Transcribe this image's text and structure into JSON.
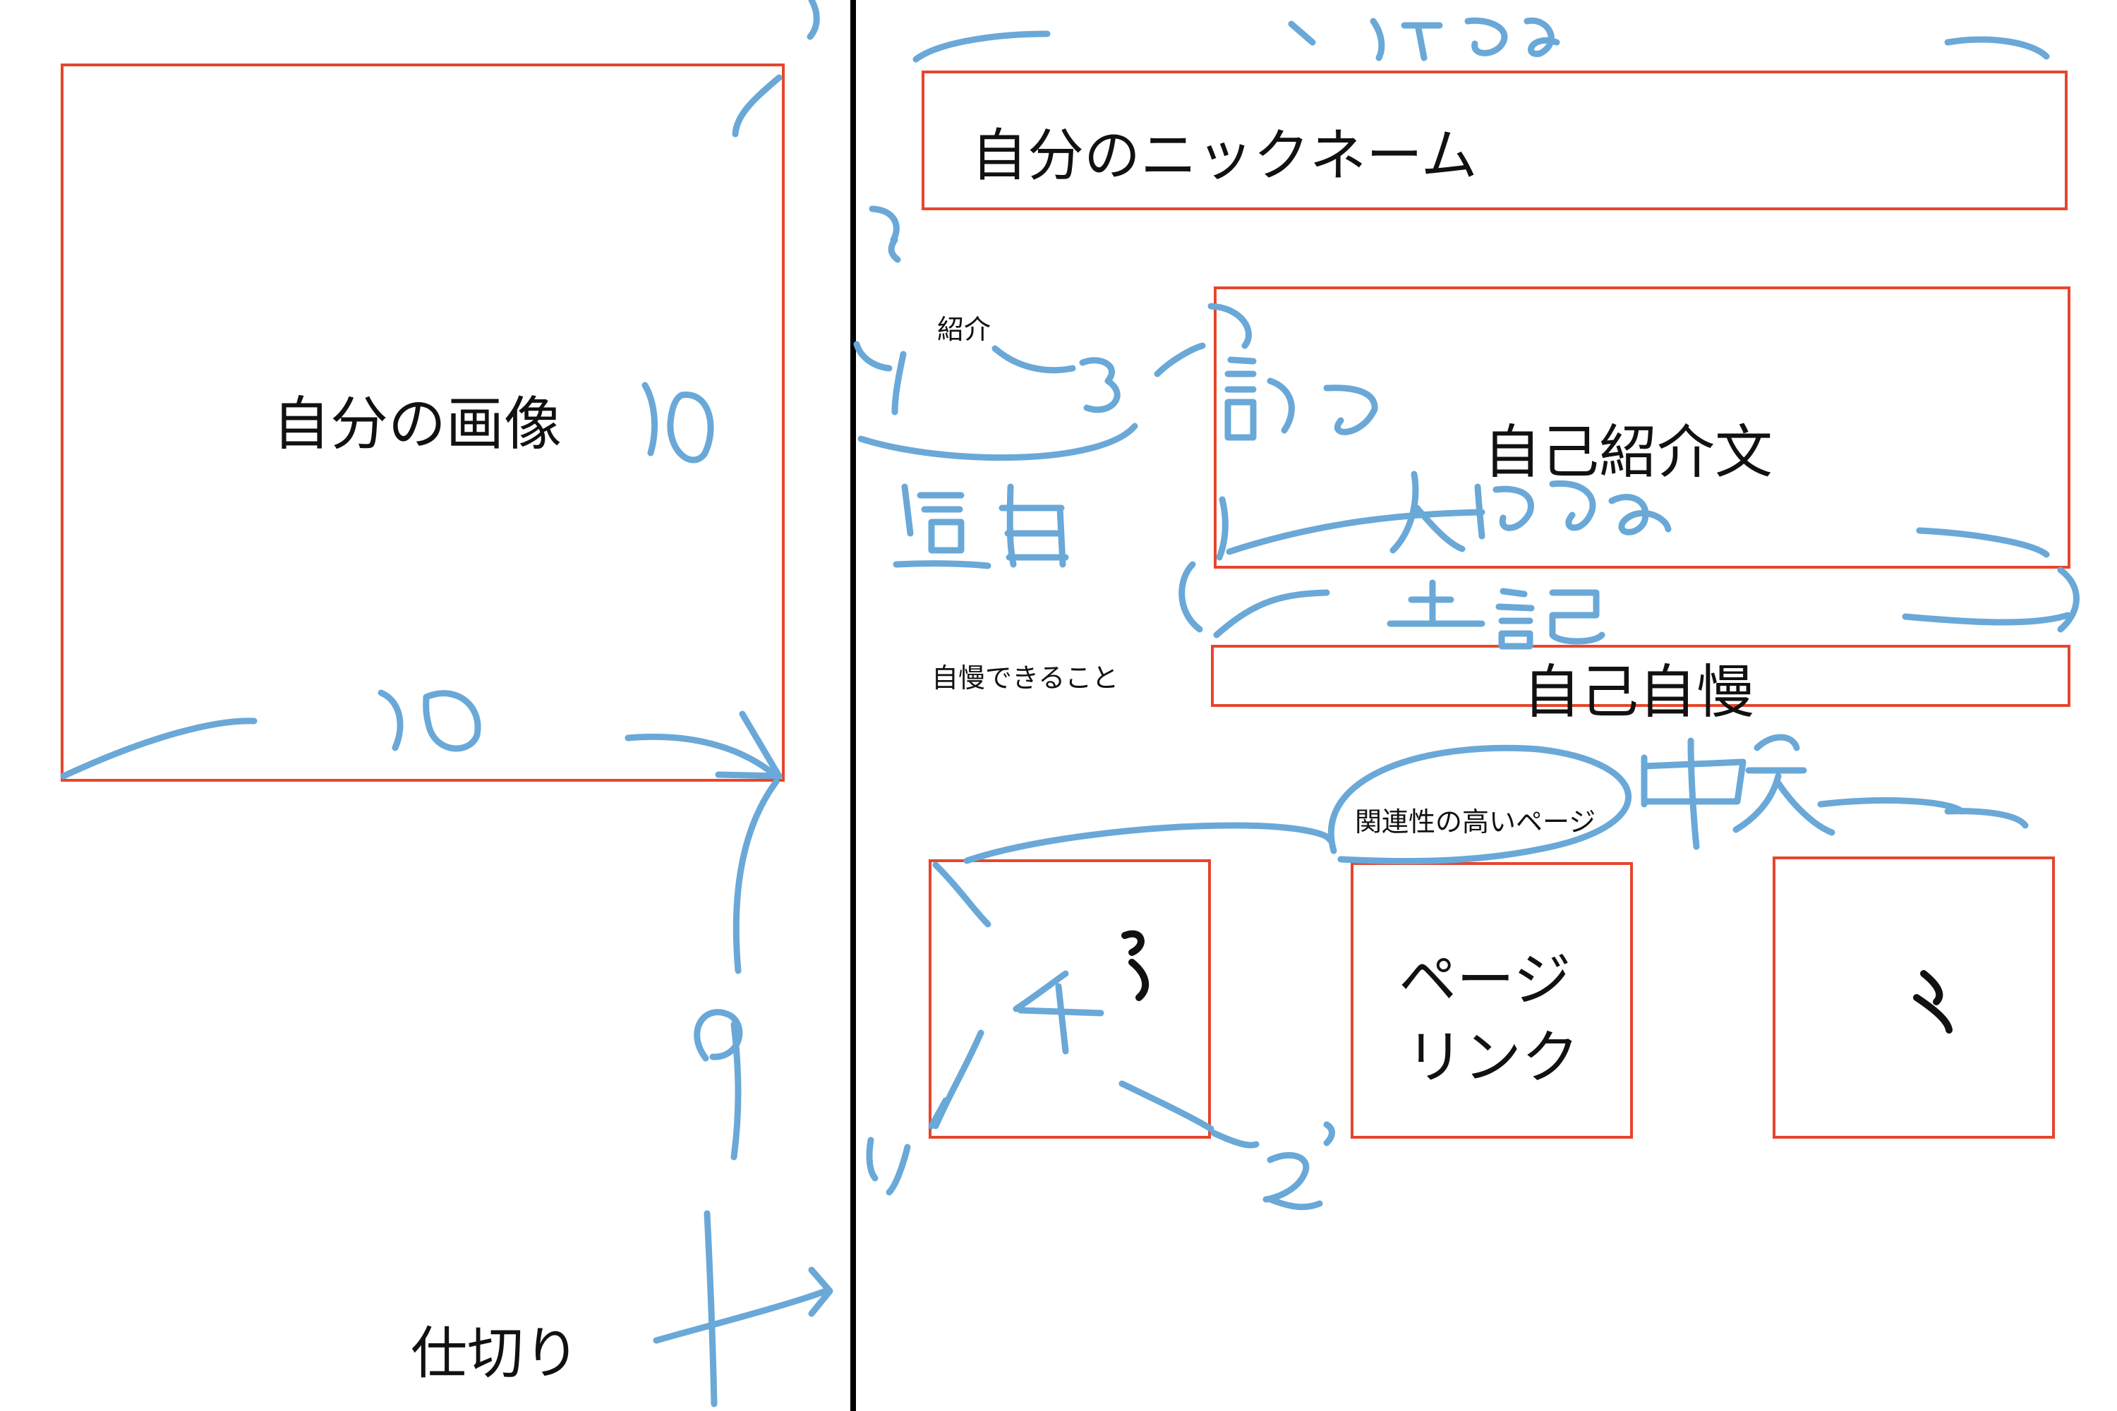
{
  "colors": {
    "box_border": "#e5462d",
    "annotation": "#6aa8d8",
    "ink": "#111111",
    "divider": "#000000"
  },
  "left": {
    "image_box_label": "自分の画像",
    "divider_label": "仕切り"
  },
  "right": {
    "nickname_box_label": "自分のニックネーム",
    "intro_label": "紹介",
    "intro_box_label": "自己紹介文",
    "pride_label": "自慢できること",
    "pride_box_label": "自己自慢",
    "related_label": "関連性の高いページ",
    "page_link_line1": "ページ",
    "page_link_line2": "リンク"
  },
  "annotations": {
    "image_width": "10",
    "image_height": "10",
    "left_lower": "9",
    "intro_ratio_left": "1",
    "intro_ratio_right": "3",
    "intro_width": "適当",
    "links_ratio_mid": "4",
    "links_ratio_left": "1",
    "links_ratio_right": "2",
    "nickname_width": "人による",
    "intro_note": "記号",
    "intro_width_note": "人による",
    "same_as_above": "上記",
    "center": "中央"
  }
}
